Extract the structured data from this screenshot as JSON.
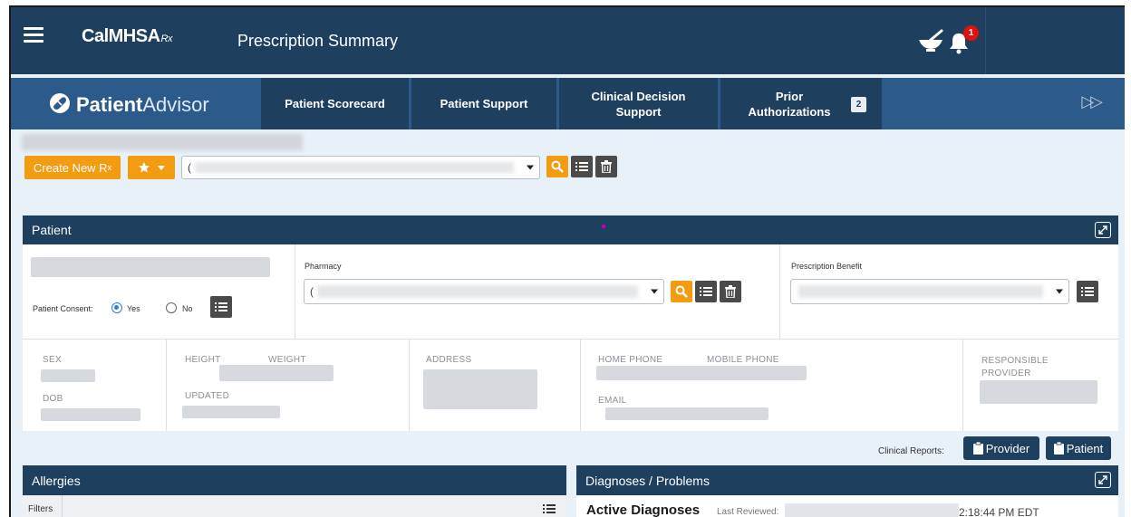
{
  "topbar": {
    "brand": "CalMHSA",
    "brand_suffix": "Rx",
    "page_title": "Prescription Summary",
    "notification_count": "1"
  },
  "navbar": {
    "logo_bold": "Patient",
    "logo_light": "Advisor",
    "tabs": [
      {
        "label": "Patient Scorecard"
      },
      {
        "label": "Patient Support"
      },
      {
        "label": "Clinical Decision\nSupport"
      },
      {
        "label": "Prior\nAuthorizations",
        "badge": "2"
      }
    ]
  },
  "toolbar": {
    "create_label": "Create New R",
    "create_sub": "x",
    "select_cursor": "("
  },
  "patient_panel": {
    "title": "Patient",
    "consent_label": "Patient Consent:",
    "consent_yes": "Yes",
    "consent_no": "No",
    "pharmacy_label": "Pharmacy",
    "pharmacy_cursor": "(",
    "benefit_label": "Prescription Benefit",
    "fields": {
      "sex": "SEX",
      "dob": "DOB",
      "height": "HEIGHT",
      "weight": "WEIGHT",
      "updated": "UPDATED",
      "address": "ADDRESS",
      "home_phone": "HOME PHONE",
      "mobile_phone": "MOBILE PHONE",
      "email": "EMAIL",
      "responsible_provider": "RESPONSIBLE PROVIDER"
    }
  },
  "clinical_reports": {
    "label": "Clinical Reports:",
    "provider_button": "Provider",
    "patient_button": "Patient"
  },
  "allergies_panel": {
    "title": "Allergies",
    "filters_label": "Filters"
  },
  "diagnoses_panel": {
    "title": "Diagnoses / Problems",
    "active_label": "Active Diagnoses",
    "last_reviewed_label": "Last Reviewed:",
    "last_reviewed_time": "2:18:44 PM EDT"
  },
  "colors": {
    "header_navy": "#1f3f5e",
    "nav_blue": "#2c5a8b",
    "accent_orange": "#f39c12",
    "badge_red": "#e01010"
  }
}
